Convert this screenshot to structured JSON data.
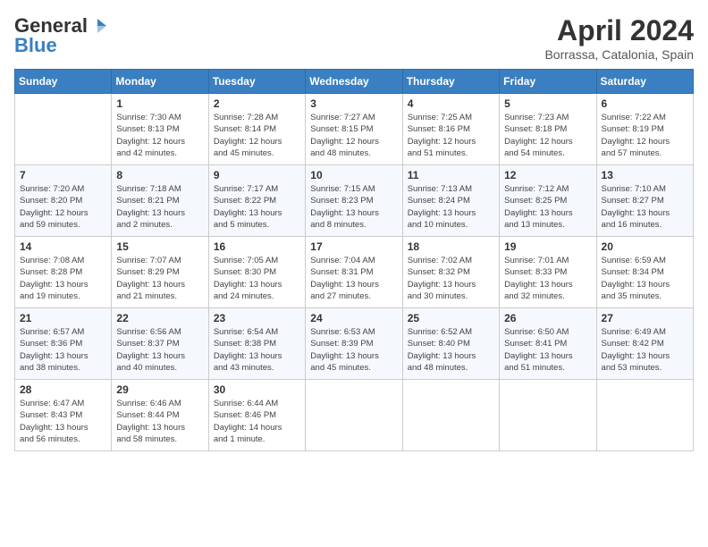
{
  "header": {
    "logo_general": "General",
    "logo_blue": "Blue",
    "title": "April 2024",
    "location": "Borrassa, Catalonia, Spain"
  },
  "days_of_week": [
    "Sunday",
    "Monday",
    "Tuesday",
    "Wednesday",
    "Thursday",
    "Friday",
    "Saturday"
  ],
  "weeks": [
    [
      {
        "day": "",
        "info": ""
      },
      {
        "day": "1",
        "info": "Sunrise: 7:30 AM\nSunset: 8:13 PM\nDaylight: 12 hours\nand 42 minutes."
      },
      {
        "day": "2",
        "info": "Sunrise: 7:28 AM\nSunset: 8:14 PM\nDaylight: 12 hours\nand 45 minutes."
      },
      {
        "day": "3",
        "info": "Sunrise: 7:27 AM\nSunset: 8:15 PM\nDaylight: 12 hours\nand 48 minutes."
      },
      {
        "day": "4",
        "info": "Sunrise: 7:25 AM\nSunset: 8:16 PM\nDaylight: 12 hours\nand 51 minutes."
      },
      {
        "day": "5",
        "info": "Sunrise: 7:23 AM\nSunset: 8:18 PM\nDaylight: 12 hours\nand 54 minutes."
      },
      {
        "day": "6",
        "info": "Sunrise: 7:22 AM\nSunset: 8:19 PM\nDaylight: 12 hours\nand 57 minutes."
      }
    ],
    [
      {
        "day": "7",
        "info": "Sunrise: 7:20 AM\nSunset: 8:20 PM\nDaylight: 12 hours\nand 59 minutes."
      },
      {
        "day": "8",
        "info": "Sunrise: 7:18 AM\nSunset: 8:21 PM\nDaylight: 13 hours\nand 2 minutes."
      },
      {
        "day": "9",
        "info": "Sunrise: 7:17 AM\nSunset: 8:22 PM\nDaylight: 13 hours\nand 5 minutes."
      },
      {
        "day": "10",
        "info": "Sunrise: 7:15 AM\nSunset: 8:23 PM\nDaylight: 13 hours\nand 8 minutes."
      },
      {
        "day": "11",
        "info": "Sunrise: 7:13 AM\nSunset: 8:24 PM\nDaylight: 13 hours\nand 10 minutes."
      },
      {
        "day": "12",
        "info": "Sunrise: 7:12 AM\nSunset: 8:25 PM\nDaylight: 13 hours\nand 13 minutes."
      },
      {
        "day": "13",
        "info": "Sunrise: 7:10 AM\nSunset: 8:27 PM\nDaylight: 13 hours\nand 16 minutes."
      }
    ],
    [
      {
        "day": "14",
        "info": "Sunrise: 7:08 AM\nSunset: 8:28 PM\nDaylight: 13 hours\nand 19 minutes."
      },
      {
        "day": "15",
        "info": "Sunrise: 7:07 AM\nSunset: 8:29 PM\nDaylight: 13 hours\nand 21 minutes."
      },
      {
        "day": "16",
        "info": "Sunrise: 7:05 AM\nSunset: 8:30 PM\nDaylight: 13 hours\nand 24 minutes."
      },
      {
        "day": "17",
        "info": "Sunrise: 7:04 AM\nSunset: 8:31 PM\nDaylight: 13 hours\nand 27 minutes."
      },
      {
        "day": "18",
        "info": "Sunrise: 7:02 AM\nSunset: 8:32 PM\nDaylight: 13 hours\nand 30 minutes."
      },
      {
        "day": "19",
        "info": "Sunrise: 7:01 AM\nSunset: 8:33 PM\nDaylight: 13 hours\nand 32 minutes."
      },
      {
        "day": "20",
        "info": "Sunrise: 6:59 AM\nSunset: 8:34 PM\nDaylight: 13 hours\nand 35 minutes."
      }
    ],
    [
      {
        "day": "21",
        "info": "Sunrise: 6:57 AM\nSunset: 8:36 PM\nDaylight: 13 hours\nand 38 minutes."
      },
      {
        "day": "22",
        "info": "Sunrise: 6:56 AM\nSunset: 8:37 PM\nDaylight: 13 hours\nand 40 minutes."
      },
      {
        "day": "23",
        "info": "Sunrise: 6:54 AM\nSunset: 8:38 PM\nDaylight: 13 hours\nand 43 minutes."
      },
      {
        "day": "24",
        "info": "Sunrise: 6:53 AM\nSunset: 8:39 PM\nDaylight: 13 hours\nand 45 minutes."
      },
      {
        "day": "25",
        "info": "Sunrise: 6:52 AM\nSunset: 8:40 PM\nDaylight: 13 hours\nand 48 minutes."
      },
      {
        "day": "26",
        "info": "Sunrise: 6:50 AM\nSunset: 8:41 PM\nDaylight: 13 hours\nand 51 minutes."
      },
      {
        "day": "27",
        "info": "Sunrise: 6:49 AM\nSunset: 8:42 PM\nDaylight: 13 hours\nand 53 minutes."
      }
    ],
    [
      {
        "day": "28",
        "info": "Sunrise: 6:47 AM\nSunset: 8:43 PM\nDaylight: 13 hours\nand 56 minutes."
      },
      {
        "day": "29",
        "info": "Sunrise: 6:46 AM\nSunset: 8:44 PM\nDaylight: 13 hours\nand 58 minutes."
      },
      {
        "day": "30",
        "info": "Sunrise: 6:44 AM\nSunset: 8:46 PM\nDaylight: 14 hours\nand 1 minute."
      },
      {
        "day": "",
        "info": ""
      },
      {
        "day": "",
        "info": ""
      },
      {
        "day": "",
        "info": ""
      },
      {
        "day": "",
        "info": ""
      }
    ]
  ]
}
